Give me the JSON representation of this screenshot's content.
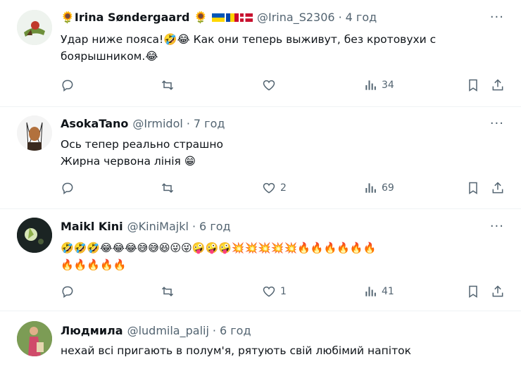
{
  "tweets": [
    {
      "name": "🌻Irina Søndergaard 🌻",
      "handle": "@Irina_S2306",
      "time": "4 год",
      "text": "Удар ниже пояса!🤣😂 Как они теперь выживут, без кротовухи с\nбоярышником.😂",
      "likes": "",
      "views": "34"
    },
    {
      "name": "AsokaTano",
      "handle": "@Irmidol",
      "time": "7 год",
      "text": "Ось тепер реально страшно\nЖирна червона лінія 😁",
      "likes": "2",
      "views": "69"
    },
    {
      "name": "Maikl Kini",
      "handle": "@KiniMajkl",
      "time": "6 год",
      "text": "🤣🤣🤣😂😂😂😅😅😆😜😜🤪🤪🤪💥💥💥💥💥🔥🔥🔥🔥🔥🔥\n🔥🔥🔥🔥🔥",
      "likes": "1",
      "views": "41"
    },
    {
      "name": "Людмила",
      "handle": "@ludmila_palij",
      "time": "6 год",
      "text": "нехай всі пригають в полум'я,  рятують свій любімий напіток",
      "likes": "",
      "views": ""
    }
  ],
  "colors": {
    "muted": "#536471",
    "text": "#0f1419",
    "divider": "#eff3f4"
  },
  "icons": [
    "more-icon",
    "reply-icon",
    "retweet-icon",
    "like-icon",
    "views-icon",
    "bookmark-icon",
    "share-icon"
  ]
}
